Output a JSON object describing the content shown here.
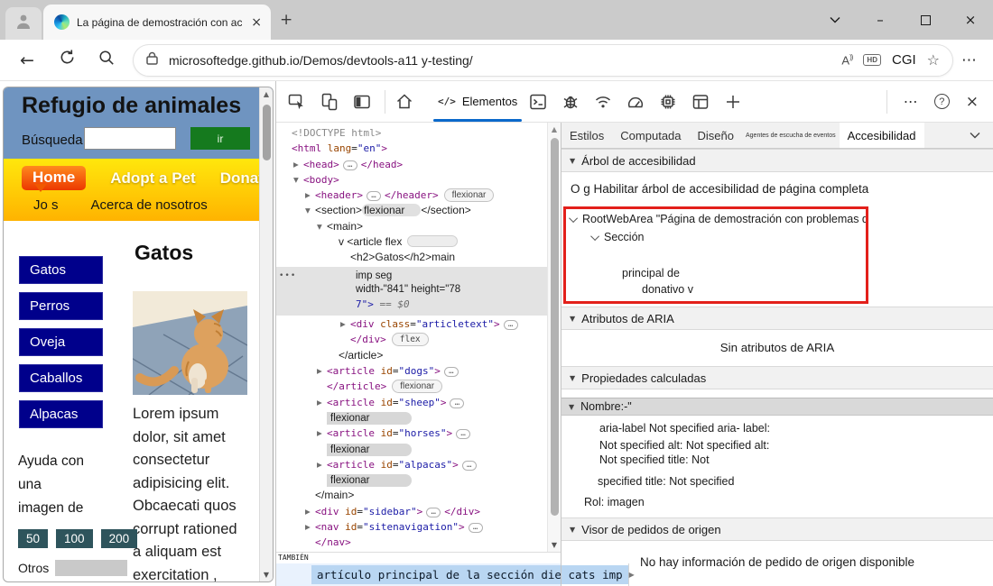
{
  "colors": {
    "devtools_accent": "#0b69cb",
    "highlight_red": "#e3201b",
    "page_header_blue": "#6f94c0",
    "nav_yellow": "#ffd400",
    "navy_button": "#00008b",
    "go_green": "#157a1e",
    "amount_teal": "#2e545c",
    "selection_blue": "#b9d6f2"
  },
  "browser": {
    "tab_title": "La página de demostración con accesibilidad es",
    "url": "microsoftedge.github.io/Demos/devtools-a11 y-testing/",
    "profile_name": "CGI",
    "hd_badge": "HD",
    "read_aloud": "A",
    "glyphs": {
      "back": "←",
      "more": "⋯",
      "star": "☆",
      "tab_close": "×",
      "new_tab": "+",
      "minimize": "–",
      "close": "×",
      "up_arrow": "▲",
      "down_arrow": "▼",
      "right_arrow": "▶"
    }
  },
  "page": {
    "title": "Refugio de animales",
    "search_label": "Búsqueda",
    "go_button": "ir",
    "nav_primary": [
      "Home",
      "Adopt a Pet",
      "Donate"
    ],
    "nav_secondary": [
      "Jo s",
      "Acerca de nosotros"
    ],
    "sidebar_buttons": [
      "Gatos",
      "Perros",
      "Oveja",
      "Caballos",
      "Alpacas"
    ],
    "article_heading": "Gatos",
    "article_lines": [
      "Lorem ipsum",
      "dolor, sit amet",
      "consectetur",
      "adipisicing elit.",
      "Obcaecati quos",
      "corrupt rationed",
      "a aliquam est",
      "exercitation ,"
    ],
    "donate_prompt_lines": [
      "Ayuda con",
      "una",
      "imagen de"
    ],
    "donate_amounts": [
      "50",
      "100",
      "200"
    ],
    "other_label": "Otros"
  },
  "devtools": {
    "toolbar": {
      "elements_tab": "Elementos",
      "code_glyph": "</>"
    },
    "tree": [
      {
        "i": 0,
        "s": [
          [
            "gray",
            "<!DOCTYPE html>"
          ]
        ]
      },
      {
        "i": 0,
        "s": [
          [
            "tag",
            "<html"
          ],
          [
            "attr",
            " lang"
          ],
          [
            "pln",
            "="
          ],
          [
            "val",
            "\"en\""
          ],
          [
            "tag",
            ">"
          ]
        ]
      },
      {
        "i": 1,
        "a": "r",
        "s": [
          [
            "tag",
            "<head>"
          ],
          [
            "dots",
            "…"
          ],
          [
            "tag",
            "</head>"
          ]
        ]
      },
      {
        "i": 1,
        "a": "d",
        "s": [
          [
            "tag",
            "<body>"
          ]
        ]
      },
      {
        "i": 2,
        "a": "r",
        "s": [
          [
            "tag",
            "<header>"
          ],
          [
            "dots",
            "…"
          ],
          [
            "tag",
            "</header>"
          ],
          [
            "pill",
            "flexionar"
          ]
        ]
      },
      {
        "i": 2,
        "a": "d",
        "s": [
          [
            "sans",
            "<section>"
          ],
          [
            "sanspill",
            "flexionar"
          ],
          [
            "sans",
            "</section>"
          ]
        ]
      },
      {
        "i": 3,
        "a": "d",
        "s": [
          [
            "sans",
            "<main>"
          ]
        ]
      },
      {
        "i": 4,
        "s": [
          [
            "sans",
            "v <article flex"
          ],
          [
            "pillempty",
            ""
          ]
        ]
      },
      {
        "i": 5,
        "s": [
          [
            "sans",
            "<h2>Gatos</h2>main"
          ]
        ]
      },
      {
        "type": "sel"
      },
      {
        "i": 5,
        "a": "r",
        "s": [
          [
            "tag",
            "<div"
          ],
          [
            "attr",
            " class"
          ],
          [
            "pln",
            "="
          ],
          [
            "val",
            "\"articletext\""
          ],
          [
            "tag",
            ">"
          ],
          [
            "dots",
            "…"
          ]
        ]
      },
      {
        "i": 5,
        "s": [
          [
            "tag",
            "</div>"
          ],
          [
            "pillmono",
            "flex"
          ]
        ]
      },
      {
        "i": 4,
        "s": [
          [
            "sans",
            "</article>"
          ]
        ]
      },
      {
        "i": 3,
        "a": "r",
        "s": [
          [
            "tag",
            "<article"
          ],
          [
            "attr",
            " id"
          ],
          [
            "pln",
            "="
          ],
          [
            "val",
            "\"dogs\""
          ],
          [
            "tag",
            ">"
          ],
          [
            "dots",
            "…"
          ]
        ]
      },
      {
        "i": 3,
        "s": [
          [
            "tag",
            "</article>"
          ],
          [
            "pill",
            "flexionar"
          ]
        ]
      },
      {
        "i": 3,
        "a": "r",
        "s": [
          [
            "tag",
            "<article"
          ],
          [
            "attr",
            " id"
          ],
          [
            "pln",
            "="
          ],
          [
            "val",
            "\"sheep\""
          ],
          [
            "tag",
            ">"
          ],
          [
            "dots",
            "…"
          ]
        ]
      },
      {
        "i": 3,
        "s": [
          [
            "pillgray",
            "flexionar"
          ]
        ]
      },
      {
        "i": 3,
        "a": "r",
        "s": [
          [
            "tag",
            "<article"
          ],
          [
            "attr",
            " id"
          ],
          [
            "pln",
            "="
          ],
          [
            "val",
            "\"horses\""
          ],
          [
            "tag",
            ">"
          ],
          [
            "dots",
            "…"
          ]
        ]
      },
      {
        "i": 3,
        "s": [
          [
            "pillgray",
            "flexionar"
          ]
        ]
      },
      {
        "i": 3,
        "a": "r",
        "s": [
          [
            "tag",
            "<article"
          ],
          [
            "attr",
            " id"
          ],
          [
            "pln",
            "="
          ],
          [
            "val",
            "\"alpacas\""
          ],
          [
            "tag",
            ">"
          ],
          [
            "dots",
            "…"
          ]
        ]
      },
      {
        "i": 3,
        "s": [
          [
            "pillgray",
            "flexionar"
          ]
        ]
      },
      {
        "i": 2,
        "s": [
          [
            "sans",
            "</main>"
          ]
        ]
      },
      {
        "i": 2,
        "a": "r",
        "s": [
          [
            "tag",
            "<div"
          ],
          [
            "attr",
            " id"
          ],
          [
            "pln",
            "="
          ],
          [
            "val",
            "\"sidebar\""
          ],
          [
            "tag",
            ">"
          ],
          [
            "dots",
            "…"
          ],
          [
            "tag",
            "</div>"
          ]
        ]
      },
      {
        "i": 2,
        "a": "r",
        "s": [
          [
            "tag",
            "<nav"
          ],
          [
            "attr",
            " id"
          ],
          [
            "pln",
            "="
          ],
          [
            "val",
            "\"sitenavigation\""
          ],
          [
            "tag",
            ">"
          ],
          [
            "dots",
            "…"
          ]
        ]
      },
      {
        "i": 2,
        "s": [
          [
            "tag",
            "</nav>"
          ]
        ]
      }
    ],
    "selected": {
      "gutter": "•••",
      "rows": [
        [
          [
            "pln",
            "imp seg"
          ]
        ],
        [
          [
            "pln",
            "width-\"841\" height=\"78"
          ]
        ],
        [
          [
            "val",
            "7\">"
          ],
          [
            "dim",
            " == $0"
          ]
        ]
      ]
    },
    "crumbs": {
      "corner": "TAMBIÉN",
      "item": "artículo principal de la sección die cats imp"
    },
    "panel": {
      "tabs": [
        {
          "label": "Estilos"
        },
        {
          "label": "Computada"
        },
        {
          "label": "Diseño"
        },
        {
          "label": "Agentes de escucha de eventos",
          "small": true
        },
        {
          "label": "Accesibilidad",
          "active": true
        }
      ],
      "tree_section": {
        "header": "Árbol de accesibilidad",
        "enable": "O g Habilitar árbol de accesibilidad de página completa",
        "rows": [
          {
            "text": "RootWebArea \"Página de demostración con problemas de accesibilidad-",
            "chev": true,
            "ind": 6,
            "mt": 0
          },
          {
            "text": "Sección",
            "chev": true,
            "ind": 30,
            "mt": 6
          },
          {
            "text": "principal de",
            "chev": false,
            "ind": 62,
            "mt": 26
          },
          {
            "text": "donativo v",
            "chev": false,
            "ind": 84,
            "mt": 4
          }
        ]
      },
      "aria_section": {
        "header": "Atributos de ARIA",
        "empty": "Sin atributos de ARIA"
      },
      "computed_section": {
        "header": "Propiedades calculadas",
        "name_row": "Nombre:-\"",
        "lines": [
          {
            "text": "aria-label Not specified aria- label:",
            "ind": 42,
            "mt": 6
          },
          {
            "text": "Not specified alt: Not specified alt:",
            "ind": 42,
            "mt": 3
          },
          {
            "text": "Not specified title: Not",
            "ind": 42,
            "mt": 0
          },
          {
            "text": "specified title: Not specified",
            "ind": 40,
            "mt": 8
          },
          {
            "text": "Rol: imagen",
            "ind": 25,
            "mt": 7
          }
        ]
      },
      "source_section": {
        "header": "Visor de pedidos de origen",
        "empty": "No hay información de pedido de origen disponible"
      }
    }
  }
}
